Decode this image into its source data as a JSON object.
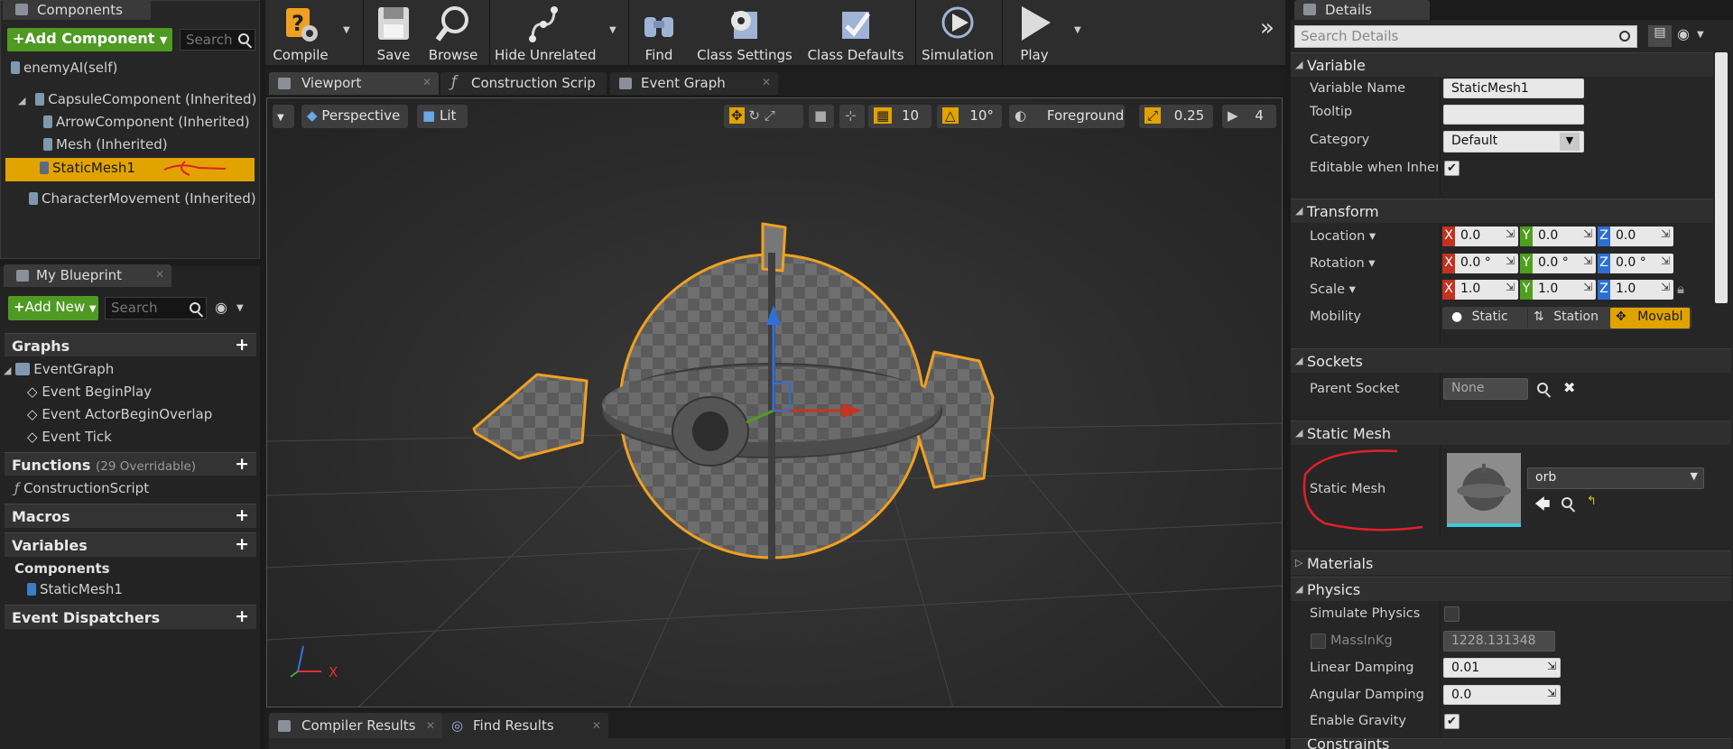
{
  "components_panel": {
    "tab_label": "Components",
    "add_component_label": "+Add Component",
    "search_placeholder": "Search",
    "root_item": "enemyAI(self)",
    "items": [
      "CapsuleComponent (Inherited)",
      "ArrowComponent (Inherited)",
      "Mesh (Inherited)",
      "StaticMesh1",
      "CharacterMovement (Inherited)"
    ]
  },
  "my_blueprint": {
    "tab_label": "My Blueprint",
    "add_new_label": "Add New",
    "search_placeholder": "Search",
    "graphs_header": "Graphs",
    "event_graph": "EventGraph",
    "events": [
      "Event BeginPlay",
      "Event ActorBeginOverlap",
      "Event Tick"
    ],
    "functions_header": "Functions",
    "functions_overridable": "(29 Overridable)",
    "construction_script": "ConstructionScript",
    "macros_header": "Macros",
    "variables_header": "Variables",
    "components_sub": "Components",
    "component_var": "StaticMesh1",
    "event_dispatchers_header": "Event Dispatchers"
  },
  "toolbar": {
    "compile": "Compile",
    "save": "Save",
    "browse": "Browse",
    "hide_unrelated": "Hide Unrelated",
    "find": "Find",
    "class_settings": "Class Settings",
    "class_defaults": "Class Defaults",
    "simulation": "Simulation",
    "play": "Play",
    "overflow": "»"
  },
  "editor_tabs": {
    "viewport": "Viewport",
    "construction_script": "Construction Scrip",
    "event_graph": "Event Graph"
  },
  "viewport": {
    "perspective": "Perspective",
    "lit": "Lit",
    "grid_snap": "10",
    "rotation_snap": "10°",
    "layer": "Foreground",
    "scale_snap": "0.25",
    "camera_speed": "4",
    "axis_x": "X"
  },
  "bottom_tabs": {
    "compiler_results": "Compiler Results",
    "find_results": "Find Results"
  },
  "details": {
    "tab_label": "Details",
    "search_placeholder": "Search Details",
    "variable_header": "Variable",
    "variable_name_label": "Variable Name",
    "variable_name_value": "StaticMesh1",
    "tooltip_label": "Tooltip",
    "tooltip_value": "",
    "category_label": "Category",
    "category_value": "Default",
    "editable_label": "Editable when Inherite",
    "editable_checked": "✔",
    "transform_header": "Transform",
    "location_label": "Location ▾",
    "rotation_label": "Rotation ▾",
    "scale_label": "Scale ▾",
    "axis_labels": [
      "X",
      "Y",
      "Z"
    ],
    "location": [
      "0.0",
      "0.0",
      "0.0"
    ],
    "rotation": [
      "0.0 °",
      "0.0 °",
      "0.0 °"
    ],
    "scale": [
      "1.0",
      "1.0",
      "1.0"
    ],
    "mobility_label": "Mobility",
    "mobility_options": [
      "Static",
      "Station",
      "Movabl"
    ],
    "sockets_header": "Sockets",
    "parent_socket_label": "Parent Socket",
    "parent_socket_value": "None",
    "static_mesh_header": "Static Mesh",
    "static_mesh_label": "Static Mesh",
    "static_mesh_value": "orb",
    "materials_header": "Materials",
    "physics_header": "Physics",
    "simulate_physics_label": "Simulate Physics",
    "mass_label": "MassInKg",
    "mass_value": "1228.131348",
    "linear_damping_label": "Linear Damping",
    "linear_damping_value": "0.01",
    "angular_damping_label": "Angular Damping",
    "angular_damping_value": "0.0",
    "enable_gravity_label": "Enable Gravity",
    "enable_gravity_checked": "✔",
    "constraints_header": "Constraints"
  },
  "colors": {
    "selection": "#e1a300",
    "add_green": "#4e9a23",
    "annotation_red": "#e0202a",
    "outline_orange": "#f0a020"
  }
}
